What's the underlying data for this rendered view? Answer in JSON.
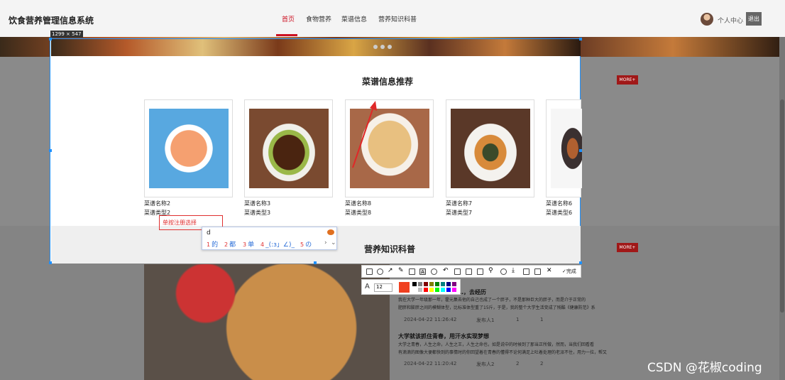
{
  "site": {
    "title": "饮食营养管理信息系统",
    "nav": [
      "首页",
      "食物营养",
      "菜谱信息",
      "营养知识科普"
    ],
    "user_center": "个人中心",
    "logout": "退出"
  },
  "capture": {
    "size_label": "1299 × 547"
  },
  "recipes": {
    "title": "菜谱信息推荐",
    "more": "MORE+",
    "cards": [
      {
        "name": "菜谱名称2",
        "type": "菜谱类型2",
        "icon": "shrimp-dish-photo"
      },
      {
        "name": "菜谱名称3",
        "type": "菜谱类型3",
        "icon": "braised-pork-dish-photo"
      },
      {
        "name": "菜谱名称8",
        "type": "菜谱类型8",
        "icon": "pancake-dish-photo"
      },
      {
        "name": "菜谱名称7",
        "type": "菜谱类型7",
        "icon": "soup-dish-photo"
      },
      {
        "name": "菜谱名称6",
        "type": "菜谱类型6",
        "icon": "noodle-dish-photo"
      }
    ]
  },
  "knowledge": {
    "title": "营养知识科普",
    "more": "MORE+",
    "articles": [
      {
        "title": "…，去经历",
        "body": "我在大学一年级那一年，霍元集去他的自己也成了一个胖子，不是那种巨大的胖子，而是介于正常的",
        "body2": "肥胖和膨胖之间的模糊体型，比标准体型重了15斤，于是，我的整个大学生活变成了残酷《健康防范》系",
        "date": "2024-04-22 11:26:42",
        "author": "发布人1",
        "likes": "1",
        "comments": "1"
      },
      {
        "title": "大学就该抓住青春，用汗水实现梦想",
        "body": "大学之青春，人生之命，人生之王，人生之命也，如是说中的时候到了那当正所做，然而，当我们回看看",
        "body2": "有滴滴的图像大便都快到的事情时的你回望着在青春的懂得不论何满足上吐着处理的老派不住，用力一拉，帮又",
        "date": "2024-04-22 11:20:42",
        "author": "发布人2",
        "likes": "2",
        "comments": "2"
      }
    ]
  },
  "input": {
    "placeholder_text": "单按注册选择"
  },
  "ime": {
    "typed": "d",
    "candidates": [
      {
        "num": "1",
        "text": "的"
      },
      {
        "num": "2",
        "text": "都"
      },
      {
        "num": "3",
        "text": "单"
      },
      {
        "num": "4",
        "text": "_(:з」∠)_"
      },
      {
        "num": "5",
        "text": "の"
      }
    ]
  },
  "toolbar": {
    "done_label": "完成",
    "font_size": "12",
    "current_color": "#f04020",
    "icons": [
      "rectangle-icon",
      "circle-icon",
      "arrow-icon",
      "pen-icon",
      "mosaic-icon",
      "text-icon",
      "number-icon",
      "undo-icon",
      "save-image-icon",
      "ocr-icon",
      "translate-icon",
      "pin-icon",
      "record-icon",
      "download-icon",
      "phone-icon",
      "bookmark-icon",
      "close-icon",
      "check-icon"
    ],
    "palette": [
      "#000000",
      "#808080",
      "#800000",
      "#808000",
      "#008000",
      "#008080",
      "#000080",
      "#800080",
      "#ffffff",
      "#c0c0c0",
      "#ff0000",
      "#ffff00",
      "#00ff00",
      "#00ffff",
      "#0000ff",
      "#ff00ff"
    ]
  },
  "watermark": "CSDN @花椒coding"
}
